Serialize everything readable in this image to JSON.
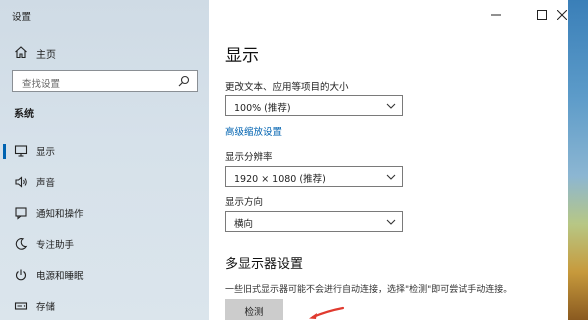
{
  "window": {
    "title": "设置"
  },
  "sidebar": {
    "home_label": "主页",
    "search_placeholder": "查找设置",
    "section_header": "系统",
    "items": [
      {
        "label": "显示",
        "icon": "monitor-icon",
        "active": true
      },
      {
        "label": "声音",
        "icon": "speaker-icon",
        "active": false
      },
      {
        "label": "通知和操作",
        "icon": "notification-icon",
        "active": false
      },
      {
        "label": "专注助手",
        "icon": "moon-icon",
        "active": false
      },
      {
        "label": "电源和睡眠",
        "icon": "power-icon",
        "active": false
      },
      {
        "label": "存储",
        "icon": "storage-icon",
        "active": false
      }
    ]
  },
  "main": {
    "title": "显示",
    "scale": {
      "label": "更改文本、应用等项目的大小",
      "value": "100% (推荐)"
    },
    "advanced_link": "高级缩放设置",
    "resolution": {
      "label": "显示分辨率",
      "value": "1920 × 1080 (推荐)"
    },
    "orientation": {
      "label": "显示方向",
      "value": "横向"
    },
    "multi_display": {
      "title": "多显示器设置",
      "description": "一些旧式显示器可能不会进行自动连接，选择\"检测\"即可尝试手动连接。",
      "detect_label": "检测"
    }
  },
  "colors": {
    "accent": "#0063b1",
    "link": "#0063b1",
    "arrow": "#e03a2f"
  }
}
